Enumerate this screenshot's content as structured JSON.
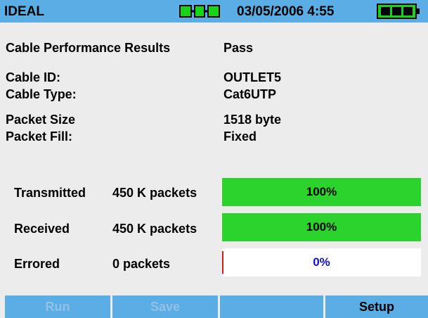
{
  "status_bar": {
    "title": "IDEAL",
    "link_icon": "link-status-icon",
    "datetime": "03/05/2006 4:55",
    "battery_icon": "battery-icon",
    "accent_color": "#5aaee5"
  },
  "summary": {
    "heading": "Cable Performance Results",
    "result": "Pass"
  },
  "details": [
    {
      "label": "Cable ID:",
      "value": "OUTLET5"
    },
    {
      "label": "Cable Type:",
      "value": "Cat6UTP"
    },
    {
      "label": "Packet Size",
      "value": "1518 byte"
    },
    {
      "label": "Packet Fill:",
      "value": "Fixed"
    }
  ],
  "stats": [
    {
      "label": "Transmitted",
      "count": "450 K packets",
      "percent_text": "100%",
      "fill_fraction": 1.0,
      "fill_color": "#2cd32c"
    },
    {
      "label": "Received",
      "count": "450 K packets",
      "percent_text": "100%",
      "fill_fraction": 1.0,
      "fill_color": "#2cd32c"
    },
    {
      "label": "Errored",
      "count": "0 packets",
      "percent_text": "0%",
      "fill_fraction": 0.0,
      "fill_color": "#d21a1a"
    }
  ],
  "softkeys": [
    {
      "label": "Run",
      "enabled": false
    },
    {
      "label": "Save",
      "enabled": false
    },
    {
      "label": "",
      "enabled": false
    },
    {
      "label": "Setup",
      "enabled": true
    }
  ]
}
